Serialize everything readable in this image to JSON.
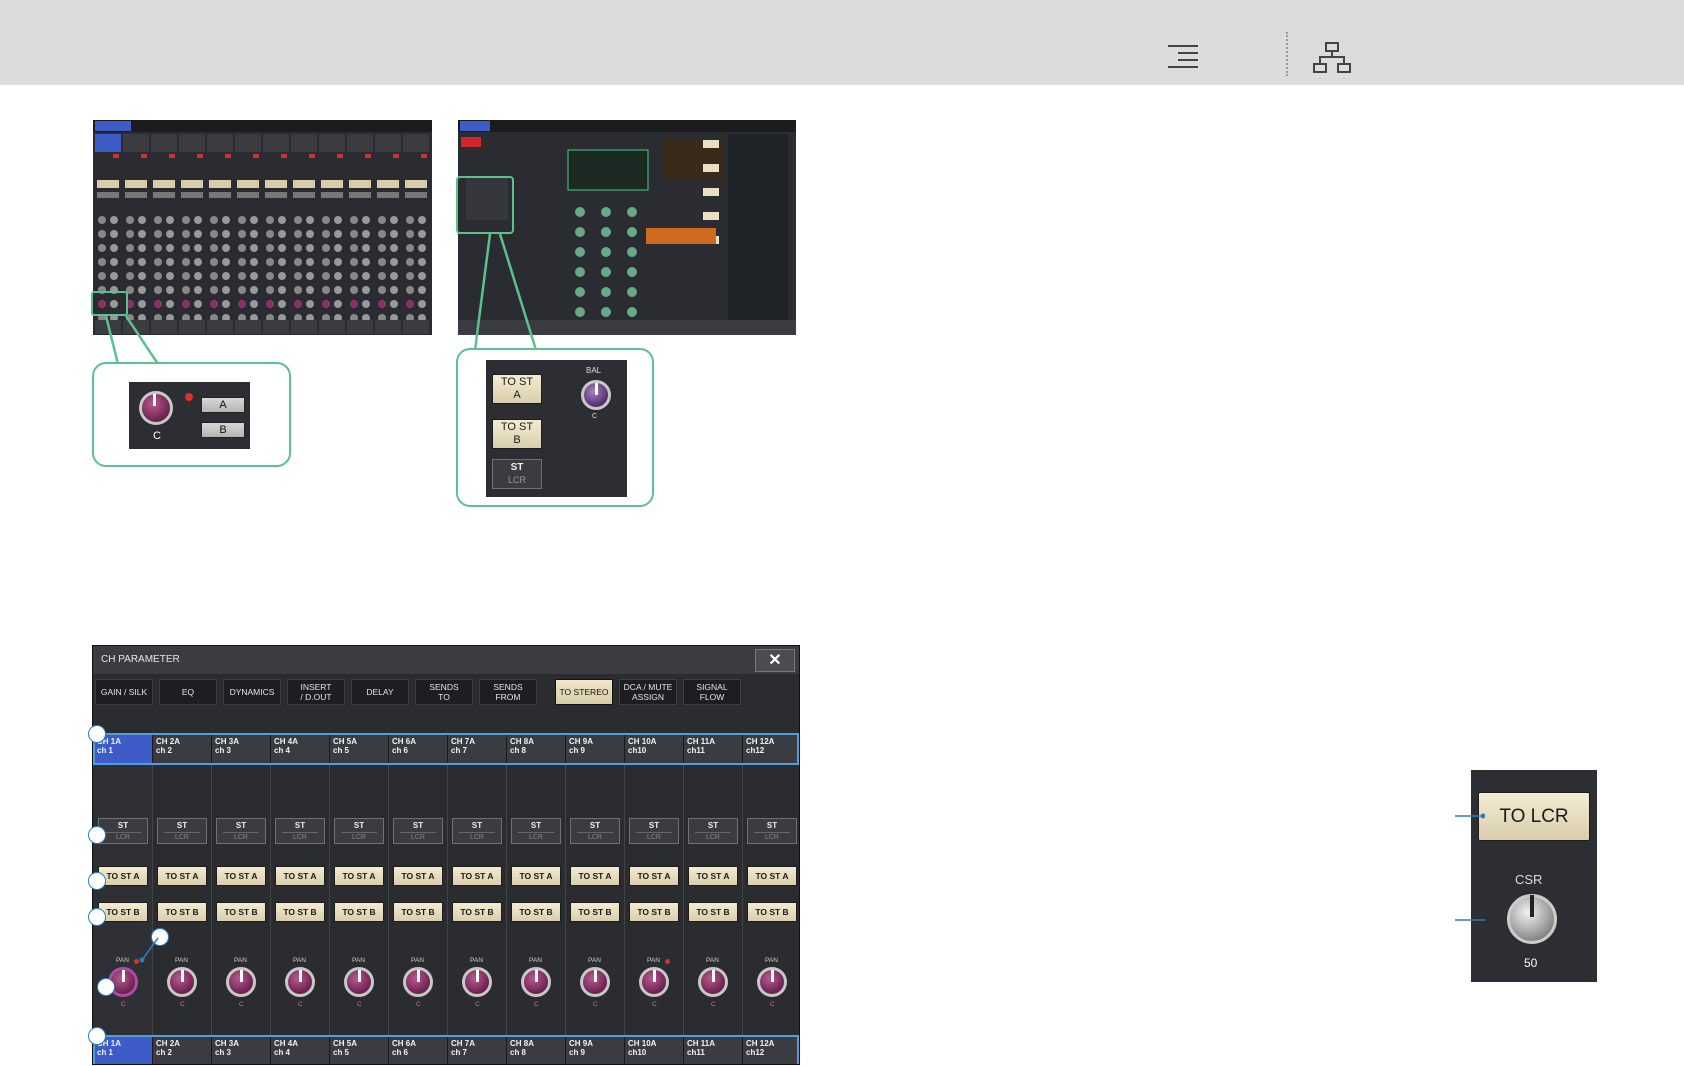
{
  "header": {
    "menu_icon": "menu-icon",
    "tree_icon": "sitemap-icon"
  },
  "callout1": {
    "knob_value": "C",
    "btn_a": "A",
    "btn_b": "B"
  },
  "callout2": {
    "to_st_a": "TO ST\nA",
    "to_st_b": "TO ST\nB",
    "st": "ST",
    "lcr": "LCR",
    "bal_label": "BAL",
    "bal_value": "C"
  },
  "window": {
    "title": "CH PARAMETER",
    "close": "✕",
    "tabs": [
      "GAIN / SILK",
      "EQ",
      "DYNAMICS",
      "INSERT\n/ D.OUT",
      "DELAY",
      "SENDS\nTO",
      "SENDS\nFROM",
      "TO STEREO",
      "DCA / MUTE\nASSIGN",
      "SIGNAL\nFLOW"
    ],
    "active_tab": 7,
    "channels": [
      {
        "top": "CH 1A",
        "bot": "ch 1"
      },
      {
        "top": "CH 2A",
        "bot": "ch 2"
      },
      {
        "top": "CH 3A",
        "bot": "ch 3"
      },
      {
        "top": "CH 4A",
        "bot": "ch 4"
      },
      {
        "top": "CH 5A",
        "bot": "ch 5"
      },
      {
        "top": "CH 6A",
        "bot": "ch 6"
      },
      {
        "top": "CH 7A",
        "bot": "ch 7"
      },
      {
        "top": "CH 8A",
        "bot": "ch 8"
      },
      {
        "top": "CH 9A",
        "bot": "ch 9"
      },
      {
        "top": "CH 10A",
        "bot": "ch10"
      },
      {
        "top": "CH 11A",
        "bot": "ch11"
      },
      {
        "top": "CH 12A",
        "bot": "ch12"
      }
    ],
    "st_label": "ST",
    "lcr_label": "LCR",
    "to_st_a": "TO ST A",
    "to_st_b": "TO ST B",
    "pan_label": "PAN",
    "pan_value": "C"
  },
  "lcr_panel": {
    "to_lcr": "TO LCR",
    "csr_label": "CSR",
    "csr_value": "50"
  },
  "colors": {
    "accent_green": "#5cc08f",
    "select_blue": "#3d5cc7",
    "callout_line": "#2a7fc1"
  }
}
